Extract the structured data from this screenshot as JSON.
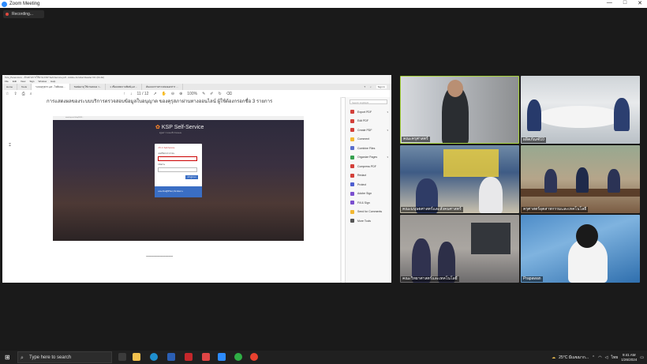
{
  "window": {
    "title": "Zoom Meeting",
    "controls": [
      "—",
      "□",
      "✕"
    ]
  },
  "recording": {
    "label": "Recording..."
  },
  "acrobat": {
    "title_bar": "Tolo_Panel.docx - ตัวอย่างการใช้งาน KSP Self-Service.pdf - Adobe Acrobat Reader DC (64-bit)",
    "menu": [
      "File",
      "Edit",
      "View",
      "Sign",
      "Window",
      "Help"
    ],
    "tabs": [
      "Home",
      "Tools",
      "ระบบคุรุสภา.pdf - ไฟล์แนบ...",
      "ขอต่ออายุ ใช้งานคลอง ว...",
      "1 เชื่อมบทความพิมพ์.pdf ...",
      "ต้นแบบการตรวจสอบเอกสาร ..."
    ],
    "sign_in": "Sign In",
    "zoom": "100%",
    "page": "11 / 12",
    "heading": "การแสดงผลของระบบบริการตรวจสอบข้อมูลใบอนุญาต ของคุรุสภาผ่านทางออนไลน์ ผู้ใช้ต้องกรอกชื่อ 3 รายการ",
    "screenshot": {
      "url": "www.ksp.or.th/ksp2018/...",
      "app_title": "KSP Self-Service",
      "subtitle": "คุรุสภา ระบบบริการตนเอง",
      "login_header": "บริการ Self-Service",
      "username_label": "เลขที่บัตรประชาชน",
      "username_value": "",
      "password_label": "รหัสผ่าน",
      "password_value": "",
      "login_button": "เข้าสู่ระบบ",
      "footer_text": "ลงทะเบียนผู้ใช้ใหม่ | ลืมรหัสผ่าน"
    },
    "dashes": "-----------------------------",
    "search_placeholder": "Search 'Highlight'",
    "tools": [
      {
        "label": "Export PDF",
        "color": "#d3403a",
        "chev": "▾"
      },
      {
        "label": "Edit PDF",
        "color": "#d3403a",
        "chev": ""
      },
      {
        "label": "Create PDF",
        "color": "#d3403a",
        "chev": "▾"
      },
      {
        "label": "Comment",
        "color": "#f2b832",
        "chev": ""
      },
      {
        "label": "Combine Files",
        "color": "#5a6ecb",
        "chev": ""
      },
      {
        "label": "Organize Pages",
        "color": "#36a04f",
        "chev": "▾"
      },
      {
        "label": "Compress PDF",
        "color": "#d3403a",
        "chev": ""
      },
      {
        "label": "Redact",
        "color": "#d3403a",
        "chev": ""
      },
      {
        "label": "Protect",
        "color": "#4e5ed0",
        "chev": ""
      },
      {
        "label": "Adobe Sign",
        "color": "#7b4fcf",
        "chev": ""
      },
      {
        "label": "Fill & Sign",
        "color": "#7b4fcf",
        "chev": ""
      },
      {
        "label": "Send for Comments",
        "color": "#f2b832",
        "chev": ""
      },
      {
        "label": "More Tools",
        "color": "#555555",
        "chev": ""
      }
    ]
  },
  "participants": [
    {
      "name": "คณะครุศาสตร์"
    },
    {
      "name": "ผลิตภัณฑ์10"
    },
    {
      "name": "คณะมนุษยศาสตร์และสังคมศาสตร์"
    },
    {
      "name": "ครุศาสตร์อุตสาหกรรมและเทคโนโลยี"
    },
    {
      "name": "คณะวิทยาศาสตร์และเทคโนโลยี"
    },
    {
      "name": "Prapawan"
    }
  ],
  "taskbar": {
    "search_placeholder": "Type here to search",
    "weather": "25°C มีเมฆมาก...",
    "language": "ไทย",
    "time": "9:41 AM",
    "date": "1/26/2024"
  }
}
